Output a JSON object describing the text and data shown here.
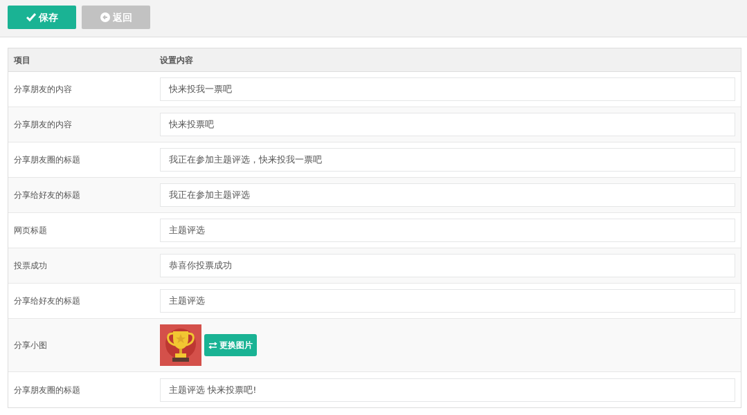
{
  "toolbar": {
    "buttons": [
      {
        "label": "保存",
        "kind": "save",
        "disabled": false
      },
      {
        "label": "返回",
        "kind": "back",
        "disabled": true
      }
    ]
  },
  "table": {
    "columns": [
      "项目",
      "设置内容"
    ],
    "rows": [
      {
        "kind": "text",
        "label": "分享朋友的内容",
        "value": "快来投我一票吧"
      },
      {
        "kind": "text",
        "label": "分享朋友的内容",
        "value": "快来投票吧"
      },
      {
        "kind": "text",
        "label": "分享朋友圈的标题",
        "value": "我正在参加主题评选，快来投我一票吧"
      },
      {
        "kind": "text",
        "label": "分享给好友的标题",
        "value": "我正在参加主题评选"
      },
      {
        "kind": "text",
        "label": "网页标题",
        "value": "主题评选"
      },
      {
        "kind": "text",
        "label": "投票成功",
        "value": "恭喜你投票成功"
      },
      {
        "kind": "text",
        "label": "分享给好友的标题",
        "value": "主题评选"
      },
      {
        "kind": "image",
        "label": "分享小图",
        "button": "更换图片"
      },
      {
        "kind": "text",
        "label": "分享朋友圈的标题",
        "value": "主题评选 快来投票吧!"
      }
    ]
  }
}
